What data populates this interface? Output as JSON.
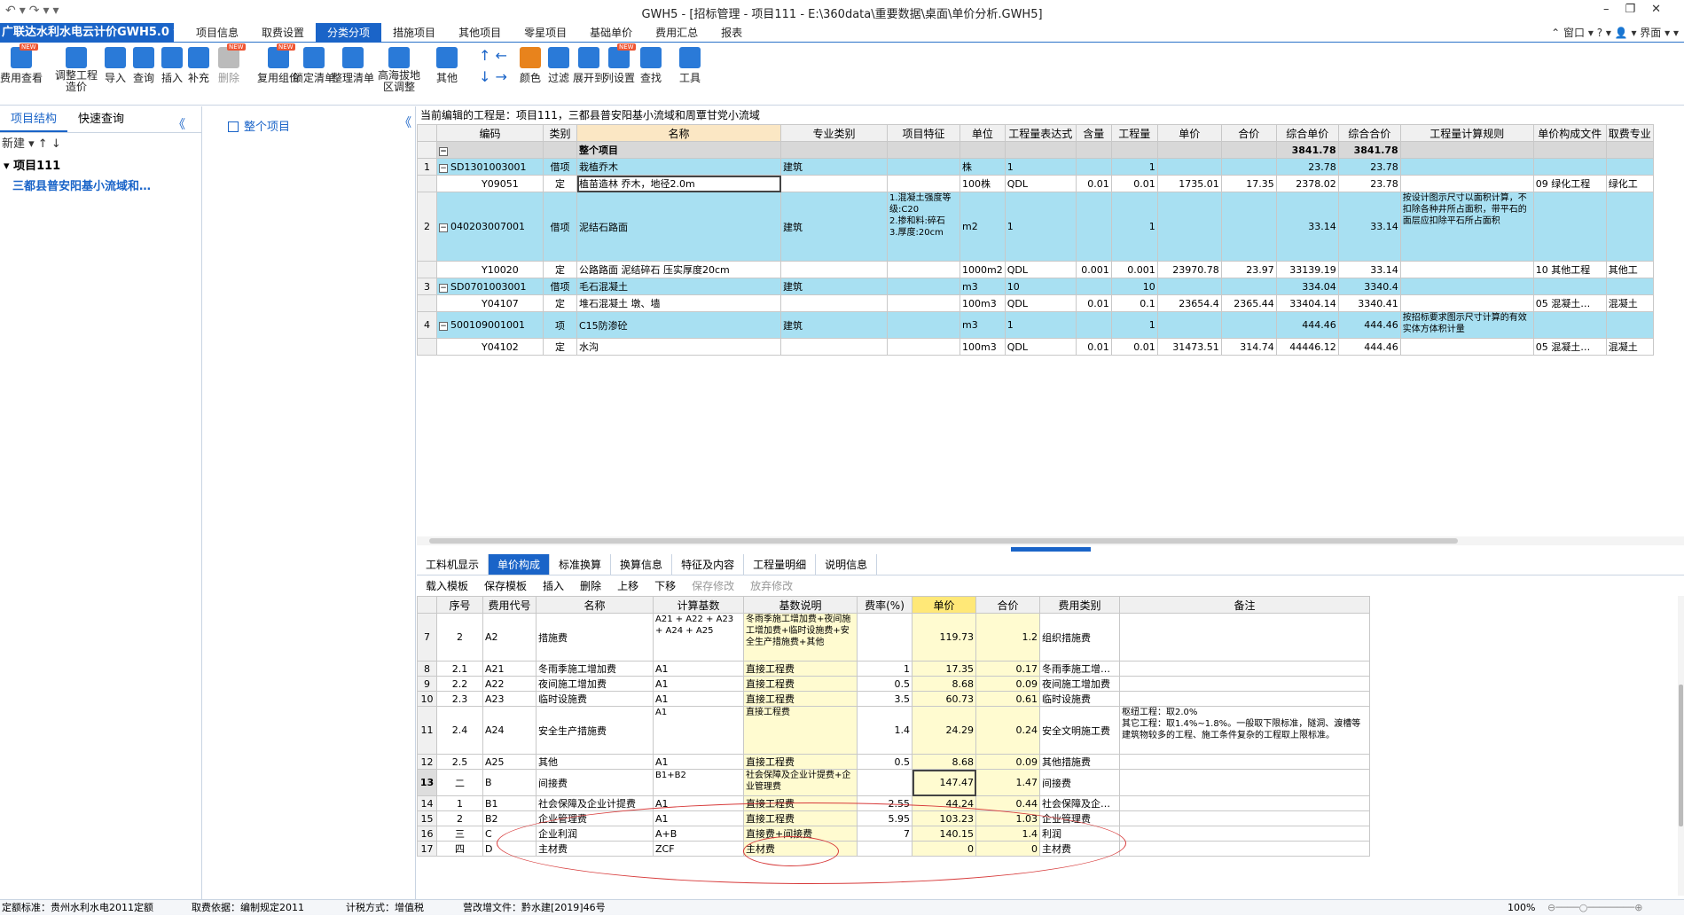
{
  "window": {
    "title": "GWH5 - [招标管理 - 项目111 - E:\\360data\\重要数据\\桌面\\单价分析.GWH5]"
  },
  "menu": {
    "brand": "广联达水利水电云计价GWH5.0 ▾",
    "items": [
      "项目信息",
      "取费设置",
      "分类分项",
      "措施项目",
      "其他项目",
      "零星项目",
      "基础单价",
      "费用汇总",
      "报表"
    ],
    "active_index": 2,
    "right": "⌃  窗口 ▾  ?  ▾  👤 ▾  界面 ▾  ▾"
  },
  "toolbar": {
    "buttons": [
      "费用查看",
      "调整工程造价",
      "导入",
      "查询",
      "插入",
      "补充",
      "删除",
      "复用组价",
      "锁定清单",
      "整理清单",
      "高海拔地区调整",
      "其他",
      "颜色",
      "过滤",
      "展开到",
      "列设置",
      "查找",
      "工具"
    ]
  },
  "left": {
    "tabs": [
      "项目结构",
      "快速查询"
    ],
    "tools": "新建 ▾  ↑  ↓",
    "root": "项目111",
    "child": "三都县普安阳基小流域和…"
  },
  "mid": {
    "node": "整个项目"
  },
  "main": {
    "current_project": "当前编辑的工程是：项目111，三都县普安阳基小流域和周覃甘党小流域"
  },
  "top_headers": [
    "编码",
    "类别",
    "名称",
    "专业类别",
    "项目特征",
    "单位",
    "工程量表达式",
    "含量",
    "工程量",
    "单价",
    "合价",
    "综合单价",
    "综合合价",
    "工程量计算规则",
    "单价构成文件",
    "取费专业"
  ],
  "top_rows": [
    {
      "no": "",
      "code": "",
      "type": "",
      "name": "整个项目",
      "spec": "",
      "feat": "",
      "unit": "",
      "expr": "",
      "cnt": "",
      "qty": "",
      "price": "",
      "total": "",
      "cprice": "3841.78",
      "ctotal": "3841.78",
      "rule": "",
      "file": "",
      "fee": "",
      "kind": "sum"
    },
    {
      "no": "1",
      "code": "SD1301003001",
      "type": "借项",
      "name": "栽植乔木",
      "spec": "建筑",
      "feat": "",
      "unit": "株",
      "expr": "1",
      "cnt": "",
      "qty": "1",
      "price": "",
      "total": "",
      "cprice": "23.78",
      "ctotal": "23.78",
      "rule": "",
      "file": "",
      "fee": "",
      "kind": "item"
    },
    {
      "no": "",
      "code": "Y09051",
      "type": "定",
      "name": "植苗造林 乔木，地径2.0m",
      "spec": "",
      "feat": "",
      "unit": "100株",
      "expr": "QDL",
      "cnt": "0.01",
      "qty": "0.01",
      "price": "1735.01",
      "total": "17.35",
      "cprice": "2378.02",
      "ctotal": "23.78",
      "rule": "",
      "file": "09 绿化工程",
      "fee": "绿化工",
      "kind": "sub"
    },
    {
      "no": "2",
      "code": "040203007001",
      "type": "借项",
      "name": "泥结石路面",
      "spec": "建筑",
      "feat": "1.混凝土强度等级:C20\n2.掺和料:碎石\n3.厚度:20cm",
      "unit": "m2",
      "expr": "1",
      "cnt": "",
      "qty": "1",
      "price": "",
      "total": "",
      "cprice": "33.14",
      "ctotal": "33.14",
      "rule": "按设计图示尺寸以面积计算，不扣除各种井所占面积，带平石的面层应扣除平石所占面积",
      "file": "",
      "fee": "",
      "kind": "item",
      "tall": true
    },
    {
      "no": "",
      "code": "Y10020",
      "type": "定",
      "name": "公路路面 泥结碎石 压实厚度20cm",
      "spec": "",
      "feat": "",
      "unit": "1000m2",
      "expr": "QDL",
      "cnt": "0.001",
      "qty": "0.001",
      "price": "23970.78",
      "total": "23.97",
      "cprice": "33139.19",
      "ctotal": "33.14",
      "rule": "",
      "file": "10 其他工程",
      "fee": "其他工",
      "kind": "sub"
    },
    {
      "no": "3",
      "code": "SD0701003001",
      "type": "借项",
      "name": "毛石混凝土",
      "spec": "建筑",
      "feat": "",
      "unit": "m3",
      "expr": "10",
      "cnt": "",
      "qty": "10",
      "price": "",
      "total": "",
      "cprice": "334.04",
      "ctotal": "3340.4",
      "rule": "",
      "file": "",
      "fee": "",
      "kind": "item"
    },
    {
      "no": "",
      "code": "Y04107",
      "type": "定",
      "name": "堆石混凝土 墩、墙",
      "spec": "",
      "feat": "",
      "unit": "100m3",
      "expr": "QDL",
      "cnt": "0.01",
      "qty": "0.1",
      "price": "23654.4",
      "total": "2365.44",
      "cprice": "33404.14",
      "ctotal": "3340.41",
      "rule": "",
      "file": "05 混凝土…",
      "fee": "混凝土",
      "kind": "sub"
    },
    {
      "no": "4",
      "code": "500109001001",
      "type": "项",
      "name": "C15防渗砼",
      "spec": "建筑",
      "feat": "",
      "unit": "m3",
      "expr": "1",
      "cnt": "",
      "qty": "1",
      "price": "",
      "total": "",
      "cprice": "444.46",
      "ctotal": "444.46",
      "rule": "按招标要求图示尺寸计算的有效实体方体积计量",
      "file": "",
      "fee": "",
      "kind": "item",
      "mid": true
    },
    {
      "no": "",
      "code": "Y04102",
      "type": "定",
      "name": "水沟",
      "spec": "",
      "feat": "",
      "unit": "100m3",
      "expr": "QDL",
      "cnt": "0.01",
      "qty": "0.01",
      "price": "31473.51",
      "total": "314.74",
      "cprice": "44446.12",
      "ctotal": "444.46",
      "rule": "",
      "file": "05 混凝土…",
      "fee": "混凝土",
      "kind": "sub"
    }
  ],
  "bottom_tabs": [
    "工料机显示",
    "单价构成",
    "标准换算",
    "换算信息",
    "特征及内容",
    "工程量明细",
    "说明信息"
  ],
  "bottom_active": 1,
  "bottom_tools": [
    "载入模板",
    "保存模板",
    "插入",
    "删除",
    "上移",
    "下移",
    "保存修改",
    "放弃修改"
  ],
  "bottom_headers": [
    "序号",
    "费用代号",
    "名称",
    "计算基数",
    "基数说明",
    "费率(%)",
    "单价",
    "合价",
    "费用类别",
    "备注"
  ],
  "bottom_rows": [
    {
      "n": "7",
      "seq": "2",
      "code": "A2",
      "name": "措施费",
      "base": "A21 + A22 + A23 + A24 + A25",
      "desc": "冬雨季施工增加费+夜间施工增加费+临时设施费+安全生产措施费+其他",
      "rate": "",
      "price": "119.73",
      "total": "1.2",
      "cat": "组织措施费",
      "note": "",
      "h": "big"
    },
    {
      "n": "8",
      "seq": "2.1",
      "code": "A21",
      "name": "冬雨季施工增加费",
      "base": "A1",
      "desc": "直接工程费",
      "rate": "1",
      "price": "17.35",
      "total": "0.17",
      "cat": "冬雨季施工增…",
      "note": ""
    },
    {
      "n": "9",
      "seq": "2.2",
      "code": "A22",
      "name": "夜间施工增加费",
      "base": "A1",
      "desc": "直接工程费",
      "rate": "0.5",
      "price": "8.68",
      "total": "0.09",
      "cat": "夜间施工增加费",
      "note": ""
    },
    {
      "n": "10",
      "seq": "2.3",
      "code": "A23",
      "name": "临时设施费",
      "base": "A1",
      "desc": "直接工程费",
      "rate": "3.5",
      "price": "60.73",
      "total": "0.61",
      "cat": "临时设施费",
      "note": ""
    },
    {
      "n": "11",
      "seq": "2.4",
      "code": "A24",
      "name": "安全生产措施费",
      "base": "A1",
      "desc": "直接工程费",
      "rate": "1.4",
      "price": "24.29",
      "total": "0.24",
      "cat": "安全文明施工费",
      "note": "枢纽工程：取2.0%\n其它工程：取1.4%~1.8%。一般取下限标准，隧洞、渡槽等建筑物较多的工程、施工条件复杂的工程取上限标准。",
      "h": "big"
    },
    {
      "n": "12",
      "seq": "2.5",
      "code": "A25",
      "name": "其他",
      "base": "A1",
      "desc": "直接工程费",
      "rate": "0.5",
      "price": "8.68",
      "total": "0.09",
      "cat": "其他措施费",
      "note": ""
    },
    {
      "n": "13",
      "seq": "二",
      "code": "B",
      "name": "间接费",
      "base": "B1+B2",
      "desc": "社会保障及企业计提费+企业管理费",
      "rate": "",
      "price": "147.47",
      "total": "1.47",
      "cat": "间接费",
      "note": "",
      "h": "med",
      "sel": true
    },
    {
      "n": "14",
      "seq": "1",
      "code": "B1",
      "name": "社会保障及企业计提费",
      "base": "A1",
      "desc": "直接工程费",
      "rate": "2.55",
      "price": "44.24",
      "total": "0.44",
      "cat": "社会保障及企…",
      "note": ""
    },
    {
      "n": "15",
      "seq": "2",
      "code": "B2",
      "name": "企业管理费",
      "base": "A1",
      "desc": "直接工程费",
      "rate": "5.95",
      "price": "103.23",
      "total": "1.03",
      "cat": "企业管理费",
      "note": ""
    },
    {
      "n": "16",
      "seq": "三",
      "code": "C",
      "name": "企业利润",
      "base": "A+B",
      "desc": "直接费+间接费",
      "rate": "7",
      "price": "140.15",
      "total": "1.4",
      "cat": "利润",
      "note": ""
    },
    {
      "n": "17",
      "seq": "四",
      "code": "D",
      "name": "主材费",
      "base": "ZCF",
      "desc": "主材费",
      "rate": "",
      "price": "0",
      "total": "0",
      "cat": "主材费",
      "note": ""
    }
  ],
  "status": {
    "quota": "定额标准：贵州水利水电2011定额",
    "fee": "取费依据：编制规定2011",
    "tax": "计税方式：增值税",
    "vat": "营改增文件：黔水建[2019]46号",
    "zoom": "100%"
  }
}
